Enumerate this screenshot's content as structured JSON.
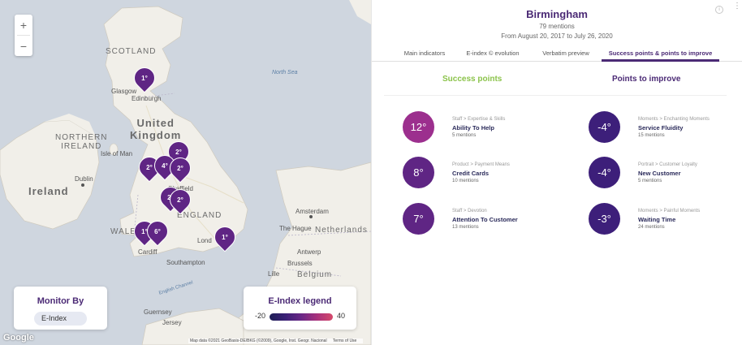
{
  "map": {
    "zoom_in": "+",
    "zoom_out": "−",
    "labels": {
      "scotland": "SCOTLAND",
      "north_sea": "North Sea",
      "glasgow": "Glasgow",
      "edinburgh": "Edinburgh",
      "northern_ireland": "NORTHERN\nIRELAND",
      "united_kingdom": "United\nKingdom",
      "isle_of_man": "Isle of Man",
      "dublin": "Dublin",
      "ireland": "Ireland",
      "sheffield": "Sheffield",
      "england": "ENGLAND",
      "wales": "WALES",
      "cardiff": "Cardiff",
      "london": "Lond",
      "southampton": "Southampton",
      "amsterdam": "Amsterdam",
      "the_hague": "The Hague",
      "netherlands": "Netherlands",
      "antwerp": "Antwerp",
      "brussels": "Brussels",
      "belgium": "Belgium",
      "lille": "Lille",
      "english_channel": "English Channel",
      "guernsey": "Guernsey",
      "jersey": "Jersey"
    },
    "pins": [
      "1°",
      "2°",
      "2°",
      "4°",
      "2°",
      "2°",
      "2°",
      "1°",
      "6°",
      "1°"
    ],
    "monitor": {
      "title": "Monitor By",
      "selected": "E-Index"
    },
    "legend": {
      "title": "E-Index legend",
      "min": "-20",
      "max": "40"
    },
    "google": "Google",
    "attribution": {
      "data": "Map data ©2021 GeoBasis-DE/BKG (©2009), Google, Inst. Geogr. Nacional",
      "terms": "Terms of Use"
    }
  },
  "panel": {
    "city": "Birmingham",
    "mentions": "79 mentions",
    "dates": "From August 20, 2017 to July 26, 2020",
    "info_icon": "i",
    "more_icon": "⋮",
    "tabs": [
      {
        "label": "Main indicators"
      },
      {
        "label": "E-index © evolution"
      },
      {
        "label": "Verbatim preview"
      },
      {
        "label": "Success points & points to improve"
      }
    ],
    "success_heading": "Success points",
    "improve_heading": "Points to improve",
    "success": [
      {
        "value": "12°",
        "crumb": "Staff > Expertise & Skills",
        "name": "Ability To Help",
        "mentions": "5 mentions",
        "color": "#9c2f8e"
      },
      {
        "value": "8°",
        "crumb": "Product > Payment Means",
        "name": "Credit Cards",
        "mentions": "10 mentions",
        "color": "#5f2584"
      },
      {
        "value": "7°",
        "crumb": "Staff > Devotion",
        "name": "Attention To Customer",
        "mentions": "13 mentions",
        "color": "#5f2584"
      }
    ],
    "improve": [
      {
        "value": "-4°",
        "crumb": "Moments > Enchanting Moments",
        "name": "Service Fluidity",
        "mentions": "15 mentions",
        "color": "#3d1f7a"
      },
      {
        "value": "-4°",
        "crumb": "Portrait > Customer Loyalty",
        "name": "New Customer",
        "mentions": "5 mentions",
        "color": "#3d1f7a"
      },
      {
        "value": "-3°",
        "crumb": "Moments > Painful Moments",
        "name": "Waiting Time",
        "mentions": "24 mentions",
        "color": "#3d1f7a"
      }
    ]
  }
}
